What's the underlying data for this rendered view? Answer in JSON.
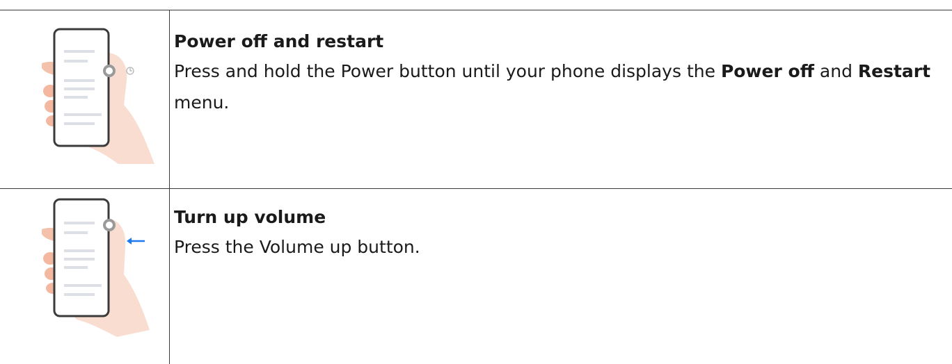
{
  "rows": [
    {
      "title": "Power off and restart",
      "body": {
        "t1": "Press and hold the Power button until your phone displays the ",
        "b1": "Power off",
        "t2": " and ",
        "b2": "Restart",
        "t3": " menu."
      },
      "illustration": "hand-holding-phone-press-power-icon"
    },
    {
      "title": "Turn up volume",
      "body": {
        "t1": "Press the Volume up button."
      },
      "illustration": "hand-holding-phone-press-volume-up-icon"
    }
  ],
  "colors": {
    "border": "#3a3a3a",
    "hand": "#f6d2c0",
    "phone_frame": "#3a3a3a",
    "screen_line": "#dcdfe6",
    "press_indicator": "#9a9a9a",
    "arrow": "#1e78f0"
  }
}
